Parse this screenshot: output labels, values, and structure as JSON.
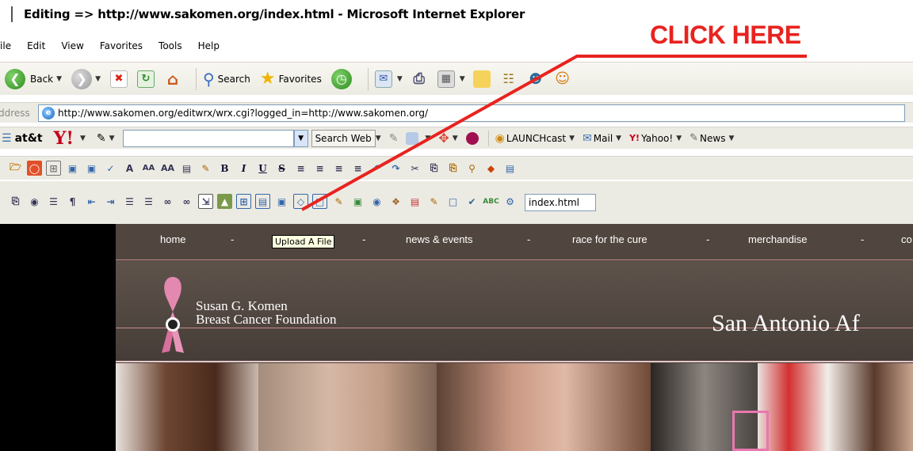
{
  "window": {
    "title": "Editing => http://www.sakomen.org/index.html - Microsoft Internet Explorer"
  },
  "menu": {
    "items": [
      "File",
      "Edit",
      "View",
      "Favorites",
      "Tools",
      "Help"
    ]
  },
  "toolbar": {
    "back_label": "Back",
    "search_label": "Search",
    "favorites_label": "Favorites"
  },
  "address": {
    "label": "Address",
    "url": "http://www.sakomen.org/editwrx/wrx.cgi?logged_in=http://www.sakomen.org/"
  },
  "yahoo_bar": {
    "att_label": "at&t",
    "search_button": "Search Web",
    "launchcast": "LAUNCHcast",
    "mail": "Mail",
    "yahoo": "Yahoo!",
    "news": "News"
  },
  "editor": {
    "filename": "index.html"
  },
  "annotation": {
    "callout": "CLICK HERE",
    "color": "#e8231f"
  },
  "site": {
    "nav": [
      "home",
      "-",
      "-",
      "news & events",
      "-",
      "race for the cure",
      "-",
      "merchandise",
      "-",
      "co"
    ],
    "tooltip": "Upload A File",
    "org_line1": "Susan G. Komen",
    "org_line2": "Breast Cancer Foundation",
    "city": "San Antonio Af"
  }
}
